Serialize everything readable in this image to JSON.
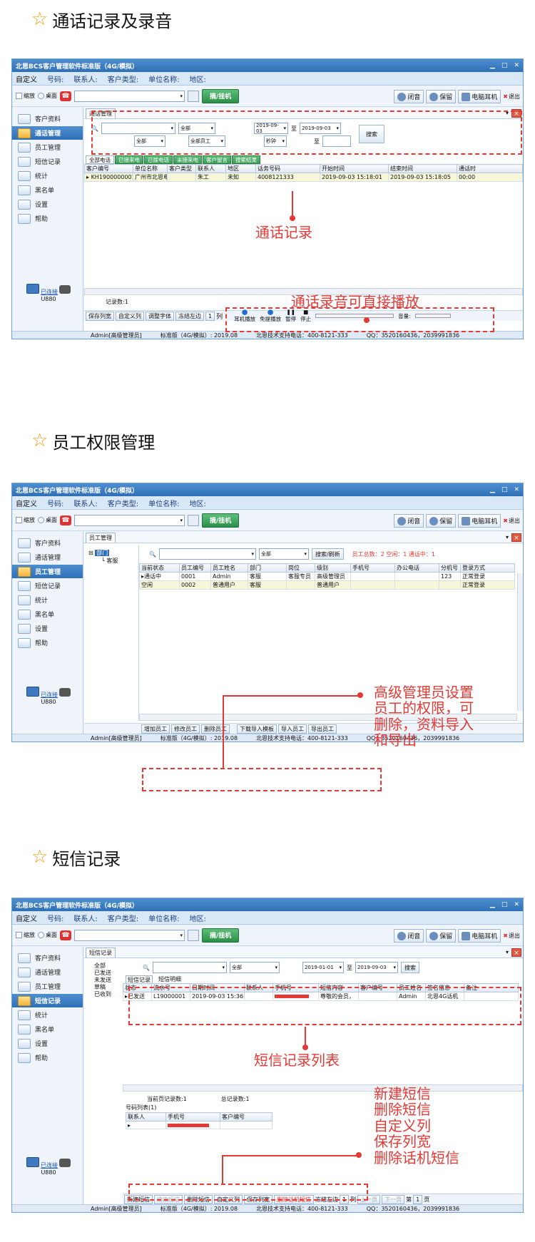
{
  "sections": [
    {
      "title": "通话记录及录音"
    },
    {
      "title": "员工权限管理"
    },
    {
      "title": "短信记录"
    }
  ],
  "app": {
    "title": "北恩BCS客户管理软件标准版（4G/模拟）",
    "custom_label": "自定义",
    "fields": [
      "号码:",
      "联系人:",
      "客户类型:",
      "单位名称:",
      "地区:"
    ],
    "shrink": "缩放",
    "desktop": "桌面",
    "hangup": "摘/挂机",
    "mute": "闭音",
    "hold": "保留",
    "pc_headset": "电脑耳机",
    "exit": "退出",
    "connected": "已连接",
    "device": "U880",
    "status_user": "Admin[高级管理员]",
    "status_ver": "标准版（4G/模拟）: 2019.08",
    "status_phone": "北恩技术支持电话：400-8121-333",
    "status_qq": "QQ：3520160436，2039991836"
  },
  "nav": [
    "客户资料",
    "通话管理",
    "员工管理",
    "短信记录",
    "统计",
    "黑名单",
    "设置",
    "帮助"
  ],
  "nav1": [
    "客户资料",
    "通话管理",
    "员工管理",
    "短信记录",
    "统计",
    "黑名单",
    "设置",
    "帮助"
  ],
  "nav3": [
    "客户资料",
    "通话管理",
    "员工管理",
    "短信记录",
    "统计",
    "黑名单",
    "设置",
    "帮助"
  ],
  "call": {
    "tab": "通话管理",
    "all": "全部",
    "all_staff": "全部员工",
    "date_from": "2019-09-03",
    "to": "至",
    "date_to": "2019-09-03",
    "seconds": "秒钟",
    "search": "搜索",
    "subtabs": [
      "全部电话",
      "已接来电",
      "已拨电话",
      "未接来电",
      "客户留言",
      "搜索结果"
    ],
    "columns": [
      "客户编号",
      "单位名称",
      "客户类型",
      "联系人",
      "地区",
      "话务号码",
      "开始时间",
      "结束时间",
      "通话时"
    ],
    "row": [
      "KH1900000001",
      "广州市北恩电",
      "",
      "朱工",
      "未知",
      "4008121333",
      "2019-09-03 15:18:01",
      "2019-09-03 15:18:05",
      "00:00"
    ],
    "records": "记录数:1",
    "bottom": [
      "保存列宽",
      "自定义列",
      "调整字体",
      "冻结左边",
      "1",
      "列"
    ],
    "earplay": "耳机播放",
    "handsfree": "免提播放",
    "pause": "暂停",
    "stop": "停止",
    "volume": "音量:",
    "anno_list": "通话记录",
    "anno_rec": "通话录音可直接播放"
  },
  "staff": {
    "tab": "员工管理",
    "tree_root": "部门",
    "tree_child": "客服",
    "all": "全部",
    "search": "搜索/刷新",
    "stats": "员工总数：2   空闲：1   通话中：1",
    "columns": [
      "当前状态",
      "员工编号",
      "员工姓名",
      "部门",
      "岗位",
      "级别",
      "手机号",
      "办公电话",
      "分机号",
      "登录方式"
    ],
    "rows": [
      [
        "通话中",
        "0001",
        "Admin",
        "客服",
        "客服专员",
        "高级管理员",
        "",
        "",
        "123",
        "正常登录"
      ],
      [
        "空闲",
        "0002",
        "普通用户",
        "客服",
        "",
        "普通用户",
        "",
        "",
        "",
        "正常登录"
      ]
    ],
    "bottom": [
      "增加员工",
      "修改员工",
      "删除员工",
      "下载导入模板",
      "导入员工",
      "导出员工"
    ],
    "anno": [
      "高级管理员设置",
      "员工的权限，可",
      "删除，资料导入",
      "和导出"
    ]
  },
  "sms": {
    "tab": "短信记录",
    "filters": [
      "全部",
      "已发送",
      "未发送",
      "草稿",
      "已收到"
    ],
    "all": "全部",
    "date_from": "2019-01-01",
    "to": "至",
    "date_to": "2019-09-03",
    "search": "搜索",
    "subtabs": [
      "短信记录",
      "短信明细"
    ],
    "columns": [
      "状态",
      "流水号",
      "日期时间",
      "联系人",
      "手机号",
      "短信内容",
      "客户编号",
      "员工姓名",
      "签名信息",
      "备注"
    ],
    "row": [
      "已发送",
      "L19000001",
      "2019-09-03 15:36",
      "",
      "",
      "尊敬的会员，",
      "",
      "Admin",
      "北恩4G话机",
      ""
    ],
    "current_records": "当前页记录数:1",
    "total_records": "总记录数:1",
    "numbers_list": "号码列表(1)",
    "num_columns": [
      "联系人",
      "手机号",
      "客户编号"
    ],
    "bottom": [
      "新建短信",
      "修改短信",
      "删除短信",
      "自定义列",
      "保存列宽",
      "删除话机短信",
      "冻结左边",
      "1",
      "列",
      "上一页",
      "下一页",
      "第",
      "1",
      "页"
    ],
    "anno_list": "短信记录列表",
    "anno_ops": [
      "新建短信",
      "删除短信",
      "自定义列",
      "保存列宽",
      "删除话机短信"
    ]
  }
}
